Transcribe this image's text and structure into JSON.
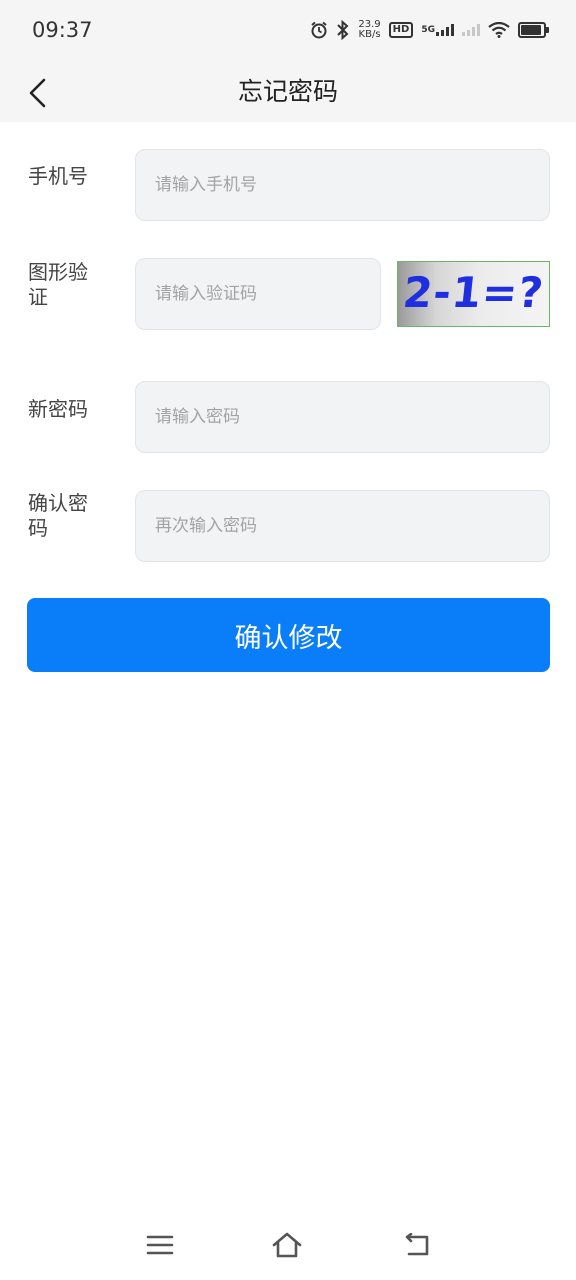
{
  "status_bar": {
    "time": "09:37",
    "net_speed_value": "23.9",
    "net_speed_unit": "KB/s",
    "hd_label": "HD",
    "network_type": "5G",
    "icons": [
      "alarm-icon",
      "bluetooth-icon",
      "hd-icon",
      "signal-5g-icon",
      "signal-icon",
      "wifi-icon",
      "battery-icon"
    ]
  },
  "nav": {
    "title": "忘记密码",
    "back_icon": "chevron-left-icon"
  },
  "form": {
    "phone": {
      "label": "手机号",
      "placeholder": "请输入手机号",
      "value": ""
    },
    "captcha": {
      "label": "图形验证",
      "label_line2": "证",
      "placeholder": "请输入验证码",
      "value": "",
      "image_text": "2-1=?"
    },
    "new_password": {
      "label": "新密码",
      "placeholder": "请输入密码",
      "value": ""
    },
    "confirm_password": {
      "label": "确认密",
      "label_line2": "码",
      "placeholder": "再次输入密码",
      "value": ""
    }
  },
  "submit_label": "确认修改",
  "system_nav": {
    "icons": [
      "menu-icon",
      "home-icon",
      "back-icon"
    ]
  },
  "colors": {
    "primary": "#0a7ef9",
    "input_bg": "#f2f3f5",
    "captcha_text": "#1f2fe0"
  }
}
